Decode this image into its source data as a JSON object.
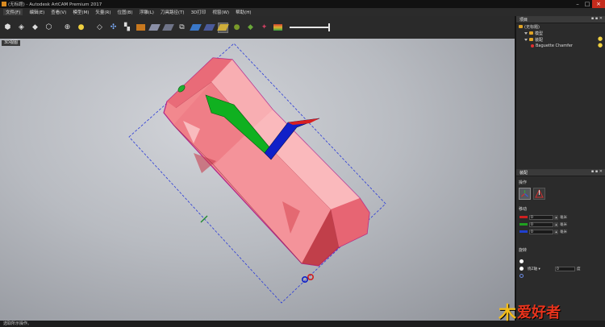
{
  "titlebar": {
    "title": "(无标题) - Autodesk ArtCAM Premium 2017",
    "controls": [
      "–",
      "□",
      "×"
    ]
  },
  "menu": [
    "文件(F)",
    "编辑(E)",
    "查看(V)",
    "模型(M)",
    "矢量(R)",
    "位图(B)",
    "浮雕(L)",
    "刀具路径(T)",
    "3D打印",
    "视窗(W)",
    "帮助(H)"
  ],
  "toolbar": {
    "icons": [
      "iso-cube-icon",
      "front-cube-icon",
      "side-cube-icon",
      "top-cube-icon",
      "zoom-fit-icon",
      "light-bulb-icon",
      "relief-plane-icon",
      "axes-icon",
      "checker-icon",
      "material-icon",
      "wireframe-icon",
      "shaded-icon",
      "frame-icon",
      "water-icon",
      "layer-icon",
      "highlight-icon",
      "sphere-icon",
      "mesh-icon",
      "star-icon",
      "color-icon"
    ],
    "slider_value": 1.0
  },
  "viewport": {
    "tab_label": "3D视图"
  },
  "panel": {
    "project": {
      "title": "项目",
      "tree": [
        "(无标题)",
        "模型",
        "装配",
        "Baguette Chamfer"
      ]
    },
    "move": {
      "title": "装配",
      "operation_label": "操作",
      "move_label": "移动",
      "rows": [
        {
          "value": "0",
          "unit": "毫米",
          "color": "#d02020"
        },
        {
          "value": "0",
          "unit": "毫米",
          "color": "#20a020"
        },
        {
          "value": "0",
          "unit": "毫米",
          "color": "#2040d0"
        }
      ],
      "rotate_label": "旋转",
      "rotate_axis": "绕Z轴 ▾",
      "rotate_value": "0",
      "rotate_unit": "度"
    }
  },
  "status": {
    "text": "选取所示操作。"
  },
  "watermark": {
    "logo": "木",
    "text": "爱好者"
  },
  "colors": {
    "accent": "#d88a20",
    "gem": "#f2888e",
    "axis_x": "#1020c8",
    "axis_y": "#10b020",
    "handle_red": "#d02020"
  }
}
